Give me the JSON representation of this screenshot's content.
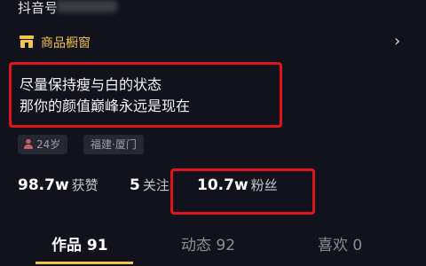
{
  "header": {
    "account_id": "抖音号"
  },
  "shop": {
    "label": "商品橱窗",
    "chevron": "›",
    "icon_color": "#f2c24a"
  },
  "bio": {
    "line1": "尽量保持瘦与白的状态",
    "line2": "那你的颜值巅峰永远是现在"
  },
  "tags": {
    "age": "24岁",
    "location": "福建·厦门"
  },
  "stats": [
    {
      "num": "98.7w",
      "label": "获赞"
    },
    {
      "num": "5",
      "label": "关注"
    },
    {
      "num": "10.7w",
      "label": "粉丝"
    }
  ],
  "tabs": [
    {
      "label": "作品 91"
    },
    {
      "label": "动态 92"
    },
    {
      "label": "喜欢 0"
    }
  ],
  "colors": {
    "background": "#11121b",
    "accent": "#f2c24a",
    "highlight_box": "#e0141c"
  }
}
